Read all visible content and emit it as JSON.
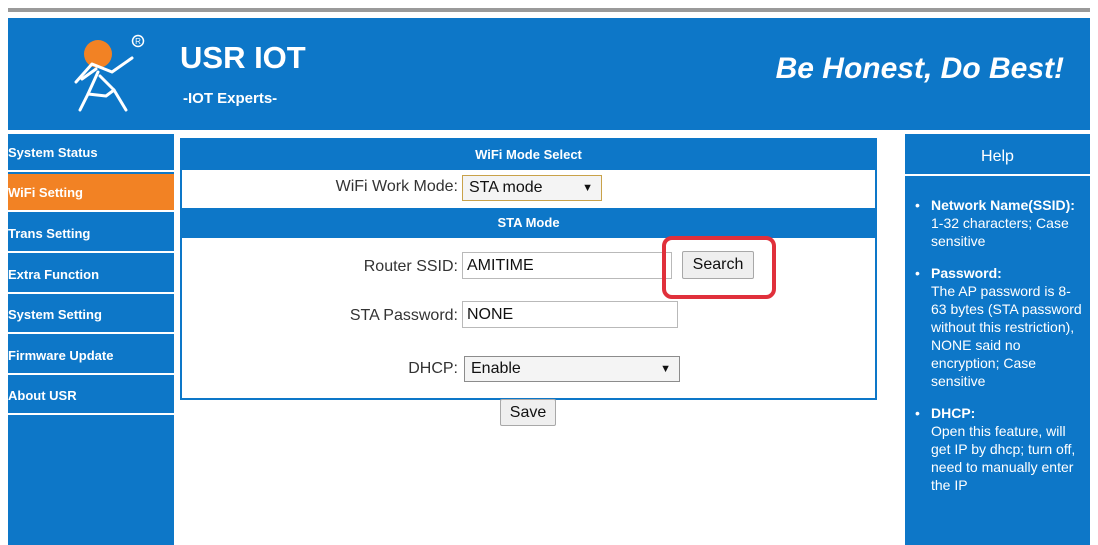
{
  "header": {
    "title": "USR IOT",
    "subtitle": "-IOT Experts-",
    "slogan": "Be Honest, Do Best!"
  },
  "sidebar": {
    "items": [
      {
        "label": "System Status",
        "active": false
      },
      {
        "label": "WiFi Setting",
        "active": true
      },
      {
        "label": "Trans Setting",
        "active": false
      },
      {
        "label": "Extra Function",
        "active": false
      },
      {
        "label": "System Setting",
        "active": false
      },
      {
        "label": "Firmware Update",
        "active": false
      },
      {
        "label": "About USR",
        "active": false
      }
    ]
  },
  "main": {
    "wifi_mode_header": "WiFi Mode Select",
    "work_mode_label": "WiFi Work Mode:",
    "work_mode_value": "STA mode",
    "sta_header": "STA Mode",
    "ssid_label": "Router SSID:",
    "ssid_value": "AMITIME",
    "search_label": "Search",
    "password_label": "STA Password:",
    "password_value": "NONE",
    "dhcp_label": "DHCP:",
    "dhcp_value": "Enable",
    "save_label": "Save"
  },
  "help": {
    "title": "Help",
    "items": [
      {
        "term": "Network Name(SSID):",
        "text": "1-32 characters; Case sensitive"
      },
      {
        "term": "Password:",
        "text": "The AP password is 8-63 bytes (STA password without this restriction), NONE said no encryption; Case sensitive"
      },
      {
        "term": "DHCP:",
        "text": "Open this feature, will get IP by dhcp; turn off, need to manually enter the IP"
      }
    ]
  },
  "colors": {
    "brand_blue": "#0d77c8",
    "active_orange": "#f28224",
    "highlight_red": "#e0303b"
  },
  "icons": {
    "logo": "running-person-logo",
    "select_caret": "triangle-down"
  }
}
